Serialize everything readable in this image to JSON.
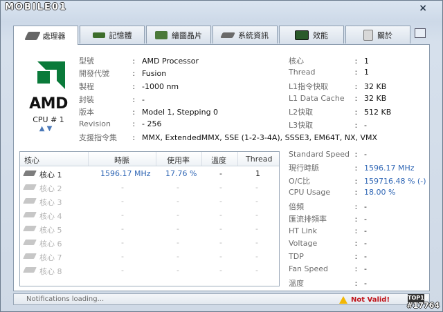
{
  "window": {
    "brand": "MOBILE01",
    "close_label": "×"
  },
  "tabs": [
    {
      "label": "處理器",
      "icon": "cpu-tab-icon",
      "color": "#5a5a5a"
    },
    {
      "label": "記憶體",
      "icon": "memory-tab-icon",
      "color": "#3d6e2c"
    },
    {
      "label": "繪圖晶片",
      "icon": "gpu-tab-icon",
      "color": "#4b7a3a"
    },
    {
      "label": "系統資訊",
      "icon": "system-tab-icon",
      "color": "#6a6a6a"
    },
    {
      "label": "效能",
      "icon": "performance-tab-icon",
      "color": "#2a5a2a"
    },
    {
      "label": "關於",
      "icon": "about-tab-icon",
      "color": "#7a7a7a"
    }
  ],
  "logo": {
    "text": "AMD"
  },
  "cpu_selector": {
    "label": "CPU # 1",
    "up": "▲",
    "down": "▼"
  },
  "info_left": [
    {
      "label": "型號",
      "value": "AMD Processor"
    },
    {
      "label": "開發代號",
      "value": "Fusion"
    },
    {
      "label": "製程",
      "value": "-1000 nm"
    },
    {
      "label": "封裝",
      "value": "-"
    },
    {
      "label": "版本",
      "value": "Model 1, Stepping 0"
    },
    {
      "label": "Revision",
      "value": "- 256"
    },
    {
      "label": "支援指令集",
      "value": "MMX, ExtendedMMX, SSE (1-2-3-4A), SSSE3, EM64T, NX, VMX"
    }
  ],
  "info_right": [
    {
      "label": "核心",
      "value": "1"
    },
    {
      "label": "Thread",
      "value": "1"
    },
    {
      "label": "L1指令快取",
      "value": "32 KB"
    },
    {
      "label": "L1 Data Cache",
      "value": "32 KB"
    },
    {
      "label": "L2快取",
      "value": "512 KB"
    },
    {
      "label": "L3快取",
      "value": "-"
    }
  ],
  "core_table": {
    "headers": [
      "核心",
      "時脈",
      "使用率",
      "溫度",
      "Thread"
    ],
    "rows": [
      {
        "core": "核心 1",
        "clock": "1596.17 MHz",
        "usage": "17.76 %",
        "temp": "-",
        "thread": "1"
      },
      {
        "core": "核心 2",
        "clock": "-",
        "usage": "-",
        "temp": "-",
        "thread": "-"
      },
      {
        "core": "核心 3",
        "clock": "-",
        "usage": "-",
        "temp": "-",
        "thread": "-"
      },
      {
        "core": "核心 4",
        "clock": "-",
        "usage": "-",
        "temp": "-",
        "thread": "-"
      },
      {
        "core": "核心 5",
        "clock": "-",
        "usage": "-",
        "temp": "-",
        "thread": "-"
      },
      {
        "core": "核心 6",
        "clock": "-",
        "usage": "-",
        "temp": "-",
        "thread": "-"
      },
      {
        "core": "核心 7",
        "clock": "-",
        "usage": "-",
        "temp": "-",
        "thread": "-"
      },
      {
        "core": "核心 8",
        "clock": "-",
        "usage": "-",
        "temp": "-",
        "thread": "-"
      }
    ]
  },
  "stats": [
    {
      "label": "Standard Speed",
      "value": "-",
      "highlight": false
    },
    {
      "label": "現行時脈",
      "value": "1596.17 MHz",
      "highlight": true
    },
    {
      "label": "O/C比",
      "value": "159716.48 % (-)",
      "highlight": true
    },
    {
      "label": "CPU Usage",
      "value": "18.00 %",
      "highlight": true
    },
    {
      "label": "倍頻",
      "value": "-",
      "highlight": false
    },
    {
      "label": "匯流排頻率",
      "value": "-",
      "highlight": false
    },
    {
      "label": "HT Link",
      "value": "-",
      "highlight": false
    },
    {
      "label": "Voltage",
      "value": "-",
      "highlight": false
    },
    {
      "label": "TDP",
      "value": "-",
      "highlight": false
    },
    {
      "label": "Fan Speed",
      "value": "-",
      "highlight": false
    },
    {
      "label": "溫度",
      "value": "-",
      "highlight": false
    }
  ],
  "status": {
    "text": "Notifications loading...",
    "warning": "Not Valid!",
    "badge": "TOP10"
  },
  "watermark": "#17764",
  "colors": {
    "accent_blue": "#2f66b5",
    "warning_red": "#c0151b",
    "amd_green": "#0a7a3a"
  }
}
